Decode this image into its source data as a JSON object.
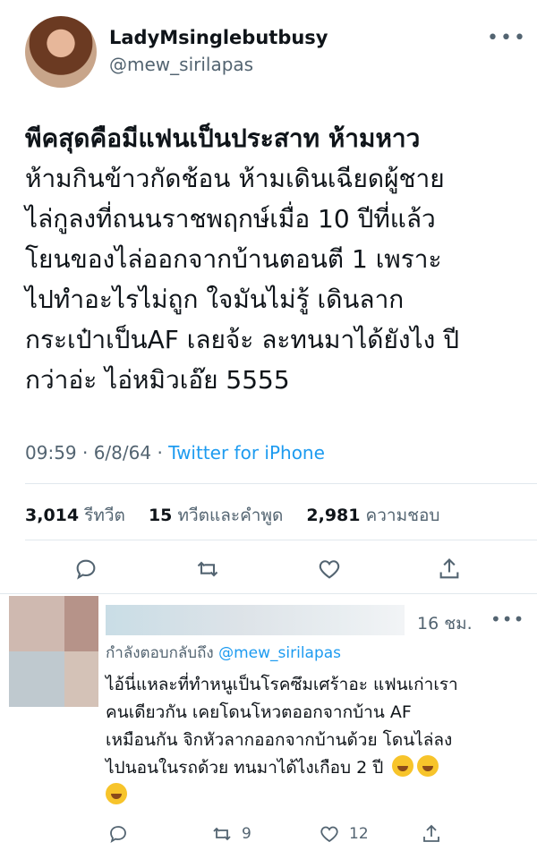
{
  "tweet": {
    "display_name": "LadyMsinglebutbusy",
    "handle": "@mew_sirilapas",
    "more_icon": "more-dots-icon",
    "text_lines": [
      "พีคสุดคือมีแฟนเป็นประสาท ห้ามหาว",
      "ห้ามกินข้าวกัดช้อน ห้ามเดินเฉียดผู้ชาย",
      "ไล่กูลงที่ถนนราชพฤกษ์เมื่อ 10 ปีที่แล้ว",
      "โยนของไล่ออกจากบ้านตอนตี 1 เพราะ",
      "ไปทำอะไรไม่ถูก ใจมันไม่รู้ เดินลาก",
      "กระเป๋าเป็นAF เลยจ้ะ ละทนมาได้ยังไง ปี",
      "กว่าอ่ะ ไอ่หมิวเอ๊ย 5555"
    ],
    "time_date": "09:59 · 6/8/64 · ",
    "source": "Twitter for iPhone",
    "stats": {
      "retweets_count": "3,014",
      "retweets_label": "รีทวีต",
      "quotes_count": "15",
      "quotes_label": "ทวีตและคำพูด",
      "likes_count": "2,981",
      "likes_label": "ความชอบ"
    },
    "actions": [
      "reply-icon",
      "retweet-icon",
      "like-icon",
      "share-icon"
    ]
  },
  "reply": {
    "time": "16 ชม.",
    "replying_prefix": "กำลังตอบกลับถึง",
    "replying_mention": "@mew_sirilapas",
    "text_lines": [
      "ไอ้นี่แหละที่ทำหนูเป็นโรคซึมเศร้าอะ แฟนเก่าเรา",
      "คนเดียวกัน เคยโดนโหวตออกจากบ้าน AF",
      "เหมือนกัน จิกหัวลากออกจากบ้านด้วย โดนไล่ลง",
      "ไปนอนในรถด้วย ทนมาได้ไงเกือบ 2 ปี"
    ],
    "emoji": "rolling-on-floor-laughing-emoji",
    "retweet_count": "9",
    "like_count": "12"
  },
  "colors": {
    "link_blue": "#1d9bf0",
    "secondary_text": "#536471",
    "primary_text": "#0f1419"
  }
}
